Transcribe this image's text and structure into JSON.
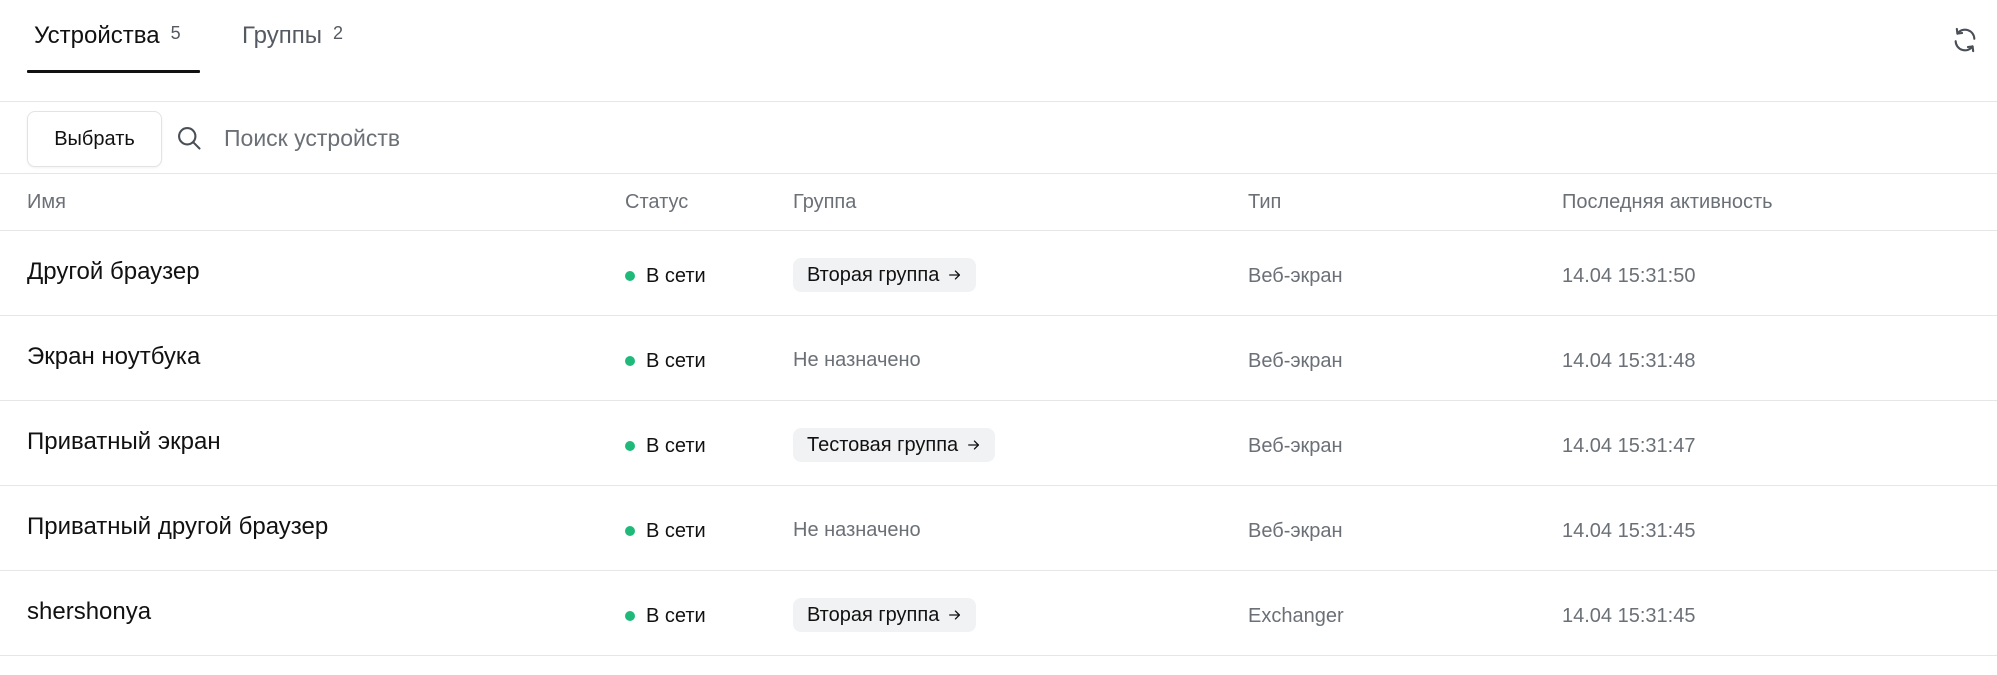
{
  "tabs": [
    {
      "label": "Устройства",
      "count": "5",
      "active": true
    },
    {
      "label": "Группы",
      "count": "2",
      "active": false
    }
  ],
  "toolbar": {
    "select_label": "Выбрать",
    "search_placeholder": "Поиск устройств",
    "search_value": ""
  },
  "table": {
    "columns": {
      "name": "Имя",
      "status": "Статус",
      "group": "Группа",
      "type": "Тип",
      "last_activity": "Последняя активность"
    },
    "rows": [
      {
        "name": "Другой браузер",
        "status": "В сети",
        "group": "Вторая группа",
        "group_assigned": true,
        "type": "Веб-экран",
        "last_activity": "14.04 15:31:50"
      },
      {
        "name": "Экран ноутбука",
        "status": "В сети",
        "group": "Не назначено",
        "group_assigned": false,
        "type": "Веб-экран",
        "last_activity": "14.04 15:31:48"
      },
      {
        "name": "Приватный экран",
        "status": "В сети",
        "group": "Тестовая группа",
        "group_assigned": true,
        "type": "Веб-экран",
        "last_activity": "14.04 15:31:47"
      },
      {
        "name": "Приватный другой браузер",
        "status": "В сети",
        "group": "Не назначено",
        "group_assigned": false,
        "type": "Веб-экран",
        "last_activity": "14.04 15:31:45"
      },
      {
        "name": "shershonya",
        "status": "В сети",
        "group": "Вторая группа",
        "group_assigned": true,
        "type": "Exchanger",
        "last_activity": "14.04 15:31:45"
      }
    ]
  },
  "icons": {
    "refresh": "refresh-icon",
    "search": "search-icon",
    "arrow": "arrow-right-icon"
  },
  "colors": {
    "online": "#1fba7a",
    "active_tab": "#111111",
    "muted": "#6b7077",
    "chip_bg": "#f1f2f3"
  }
}
